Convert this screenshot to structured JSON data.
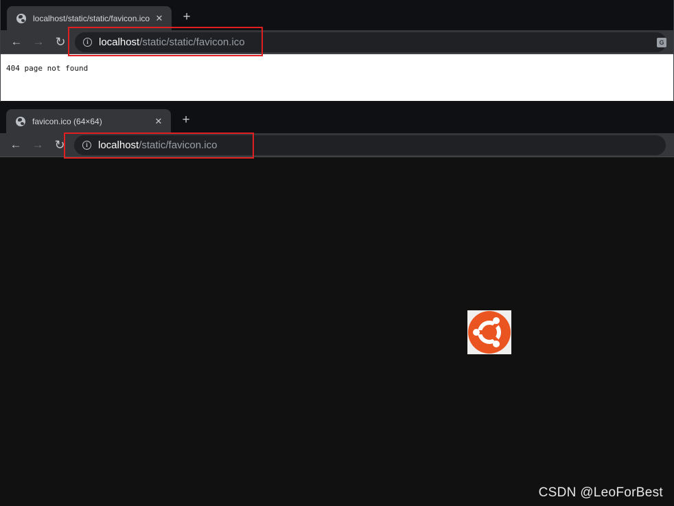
{
  "window1": {
    "tab": {
      "title": "localhost/static/static/favicon.ico",
      "close_label": "✕"
    },
    "new_tab_label": "+",
    "nav": {
      "back": "←",
      "forward": "→",
      "reload": "↻"
    },
    "omnibox": {
      "info_glyph": "i",
      "url_host": "localhost",
      "url_path": "/static/static/favicon.ico"
    },
    "translate_glyph": "G",
    "page": {
      "text": "404 page not found"
    }
  },
  "window2": {
    "tab": {
      "title": "favicon.ico (64×64)",
      "close_label": "✕"
    },
    "new_tab_label": "+",
    "nav": {
      "back": "←",
      "forward": "→",
      "reload": "↻"
    },
    "omnibox": {
      "info_glyph": "i",
      "url_host": "localhost",
      "url_path": "/static/favicon.ico"
    },
    "image": {
      "logo_color": "#e95420",
      "background": "#f0efed"
    }
  },
  "annotation": {
    "color": "#e02020"
  },
  "watermark": {
    "text": "CSDN @LeoForBest"
  }
}
